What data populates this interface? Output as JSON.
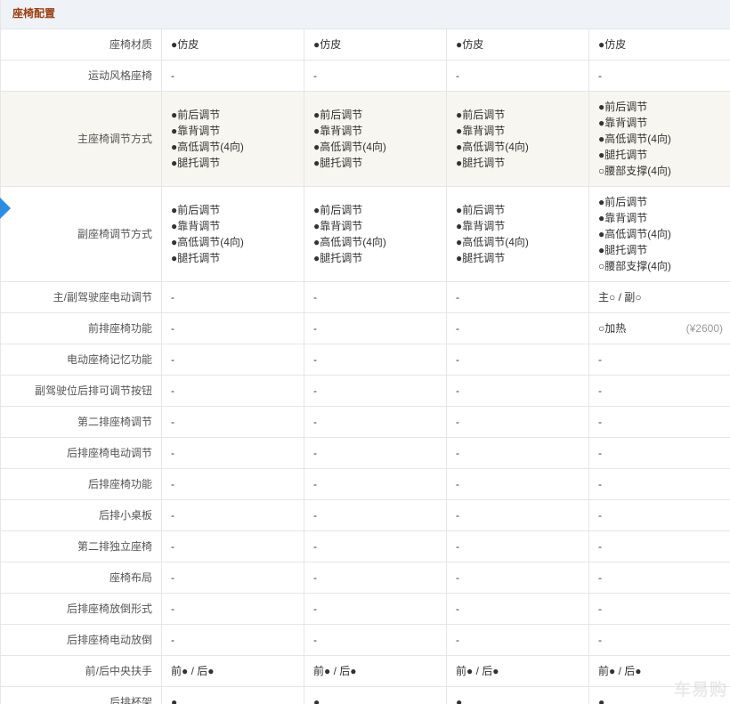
{
  "colors": {
    "header_bg": "#eff2f7",
    "header_text": "#9c3e10",
    "highlight_bg": "#f8f6f1",
    "indicator": "#2b8de3"
  },
  "section": {
    "title": "座椅配置"
  },
  "rows": [
    {
      "label": "座椅材质",
      "cells": [
        {
          "lines": [
            "●仿皮"
          ]
        },
        {
          "lines": [
            "●仿皮"
          ]
        },
        {
          "lines": [
            "●仿皮"
          ]
        },
        {
          "lines": [
            "●仿皮"
          ]
        }
      ]
    },
    {
      "label": "运动风格座椅",
      "cells": [
        {
          "lines": [
            "-"
          ]
        },
        {
          "lines": [
            "-"
          ]
        },
        {
          "lines": [
            "-"
          ]
        },
        {
          "lines": [
            "-"
          ]
        }
      ]
    },
    {
      "label": "主座椅调节方式",
      "highlighted": true,
      "cells": [
        {
          "lines": [
            "●前后调节",
            "●靠背调节",
            "●高低调节(4向)",
            "●腿托调节"
          ]
        },
        {
          "lines": [
            "●前后调节",
            "●靠背调节",
            "●高低调节(4向)",
            "●腿托调节"
          ]
        },
        {
          "lines": [
            "●前后调节",
            "●靠背调节",
            "●高低调节(4向)",
            "●腿托调节"
          ]
        },
        {
          "lines": [
            "●前后调节",
            "●靠背调节",
            "●高低调节(4向)",
            "●腿托调节",
            "○腰部支撑(4向)"
          ]
        }
      ]
    },
    {
      "label": "副座椅调节方式",
      "cells": [
        {
          "lines": [
            "●前后调节",
            "●靠背调节",
            "●高低调节(4向)",
            "●腿托调节"
          ]
        },
        {
          "lines": [
            "●前后调节",
            "●靠背调节",
            "●高低调节(4向)",
            "●腿托调节"
          ]
        },
        {
          "lines": [
            "●前后调节",
            "●靠背调节",
            "●高低调节(4向)",
            "●腿托调节"
          ]
        },
        {
          "lines": [
            "●前后调节",
            "●靠背调节",
            "●高低调节(4向)",
            "●腿托调节",
            "○腰部支撑(4向)"
          ]
        }
      ]
    },
    {
      "label": "主/副驾驶座电动调节",
      "cells": [
        {
          "lines": [
            "-"
          ]
        },
        {
          "lines": [
            "-"
          ]
        },
        {
          "lines": [
            "-"
          ]
        },
        {
          "lines": [
            "主○ / 副○"
          ]
        }
      ]
    },
    {
      "label": "前排座椅功能",
      "cells": [
        {
          "lines": [
            "-"
          ]
        },
        {
          "lines": [
            "-"
          ]
        },
        {
          "lines": [
            "-"
          ]
        },
        {
          "lines": [
            "○加热"
          ],
          "price": "(¥2600)"
        }
      ]
    },
    {
      "label": "电动座椅记忆功能",
      "cells": [
        {
          "lines": [
            "-"
          ]
        },
        {
          "lines": [
            "-"
          ]
        },
        {
          "lines": [
            "-"
          ]
        },
        {
          "lines": [
            "-"
          ]
        }
      ]
    },
    {
      "label": "副驾驶位后排可调节按钮",
      "cells": [
        {
          "lines": [
            "-"
          ]
        },
        {
          "lines": [
            "-"
          ]
        },
        {
          "lines": [
            "-"
          ]
        },
        {
          "lines": [
            "-"
          ]
        }
      ]
    },
    {
      "label": "第二排座椅调节",
      "cells": [
        {
          "lines": [
            "-"
          ]
        },
        {
          "lines": [
            "-"
          ]
        },
        {
          "lines": [
            "-"
          ]
        },
        {
          "lines": [
            "-"
          ]
        }
      ]
    },
    {
      "label": "后排座椅电动调节",
      "cells": [
        {
          "lines": [
            "-"
          ]
        },
        {
          "lines": [
            "-"
          ]
        },
        {
          "lines": [
            "-"
          ]
        },
        {
          "lines": [
            "-"
          ]
        }
      ]
    },
    {
      "label": "后排座椅功能",
      "cells": [
        {
          "lines": [
            "-"
          ]
        },
        {
          "lines": [
            "-"
          ]
        },
        {
          "lines": [
            "-"
          ]
        },
        {
          "lines": [
            "-"
          ]
        }
      ]
    },
    {
      "label": "后排小桌板",
      "cells": [
        {
          "lines": [
            "-"
          ]
        },
        {
          "lines": [
            "-"
          ]
        },
        {
          "lines": [
            "-"
          ]
        },
        {
          "lines": [
            "-"
          ]
        }
      ]
    },
    {
      "label": "第二排独立座椅",
      "cells": [
        {
          "lines": [
            "-"
          ]
        },
        {
          "lines": [
            "-"
          ]
        },
        {
          "lines": [
            "-"
          ]
        },
        {
          "lines": [
            "-"
          ]
        }
      ]
    },
    {
      "label": "座椅布局",
      "cells": [
        {
          "lines": [
            "-"
          ]
        },
        {
          "lines": [
            "-"
          ]
        },
        {
          "lines": [
            "-"
          ]
        },
        {
          "lines": [
            "-"
          ]
        }
      ]
    },
    {
      "label": "后排座椅放倒形式",
      "cells": [
        {
          "lines": [
            "-"
          ]
        },
        {
          "lines": [
            "-"
          ]
        },
        {
          "lines": [
            "-"
          ]
        },
        {
          "lines": [
            "-"
          ]
        }
      ]
    },
    {
      "label": "后排座椅电动放倒",
      "cells": [
        {
          "lines": [
            "-"
          ]
        },
        {
          "lines": [
            "-"
          ]
        },
        {
          "lines": [
            "-"
          ]
        },
        {
          "lines": [
            "-"
          ]
        }
      ]
    },
    {
      "label": "前/后中央扶手",
      "cells": [
        {
          "lines": [
            "前● / 后●"
          ]
        },
        {
          "lines": [
            "前● / 后●"
          ]
        },
        {
          "lines": [
            "前● / 后●"
          ]
        },
        {
          "lines": [
            "前● / 后●"
          ]
        }
      ]
    },
    {
      "label": "后排杯架",
      "cells": [
        {
          "lines": [
            "●"
          ]
        },
        {
          "lines": [
            "●"
          ]
        },
        {
          "lines": [
            "●"
          ]
        },
        {
          "lines": [
            "●"
          ]
        }
      ]
    }
  ],
  "watermark": "车易购"
}
